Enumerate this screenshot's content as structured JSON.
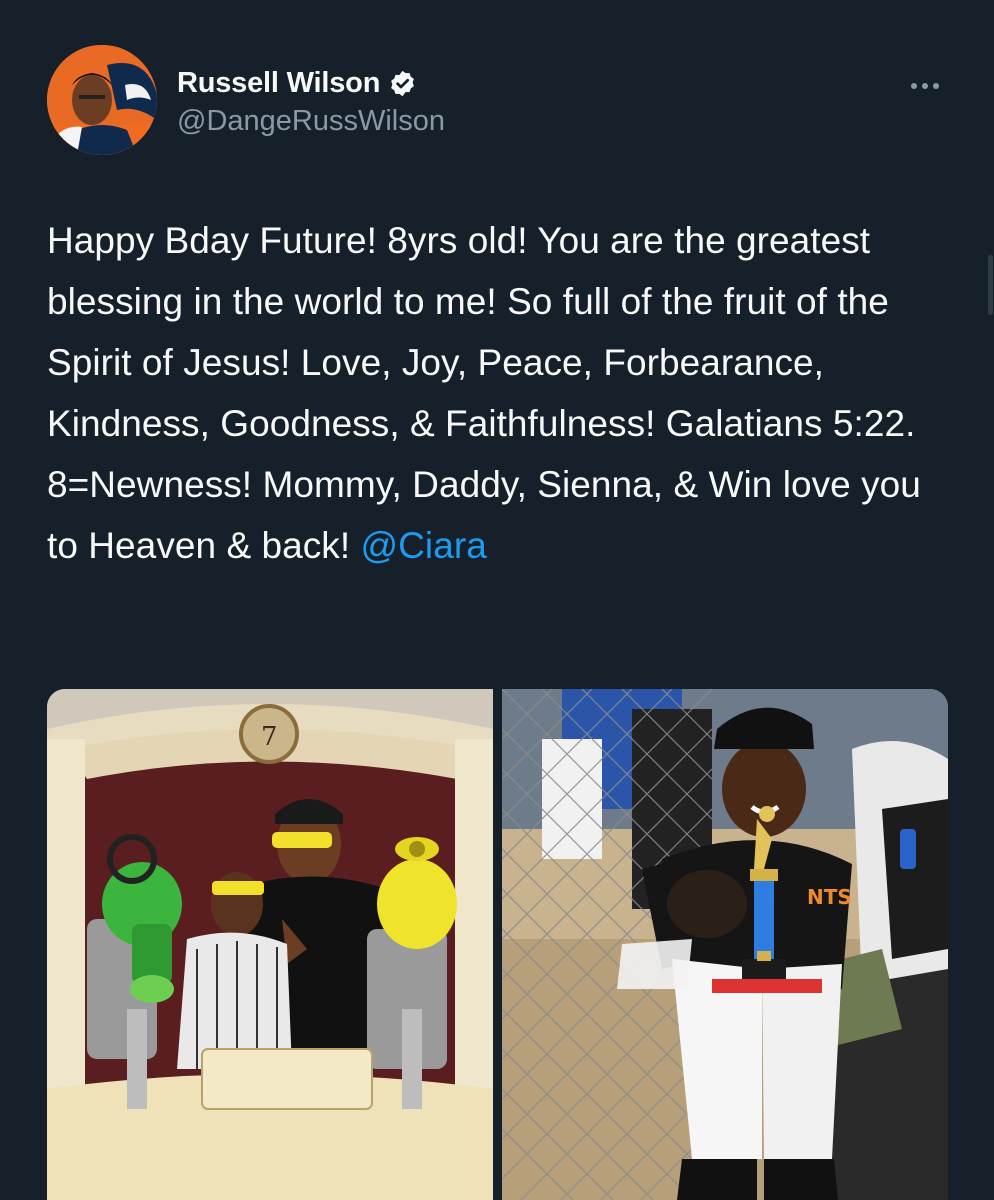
{
  "tweet": {
    "author": {
      "display_name": "Russell Wilson",
      "handle": "@DangeRussWilson",
      "verified": true,
      "avatar_icon": "profile-photo"
    },
    "more_icon": "more-horizontal-icon",
    "text": "Happy Bday Future! 8yrs old! You are the greatest blessing in the world to me! So full of the fruit of the Spirit of Jesus! Love, Joy, Peace, Forbearance, Kindness, Goodness, & Faithfulness! Galatians 5:22. 8=Newness! Mommy, Daddy, Sienna, & Win love you to Heaven & back!",
    "mention": "@Ciara",
    "media": [
      {
        "type": "photo",
        "alt": "Photo of father and son on an amusement ride wearing yellow glasses"
      },
      {
        "type": "photo",
        "alt": "Photo of boy in baseball uniform holding a trophy"
      }
    ]
  },
  "colors": {
    "background": "#15202b",
    "text": "#f7f9f9",
    "secondary": "#8b98a5",
    "link": "#1d9bf0"
  }
}
